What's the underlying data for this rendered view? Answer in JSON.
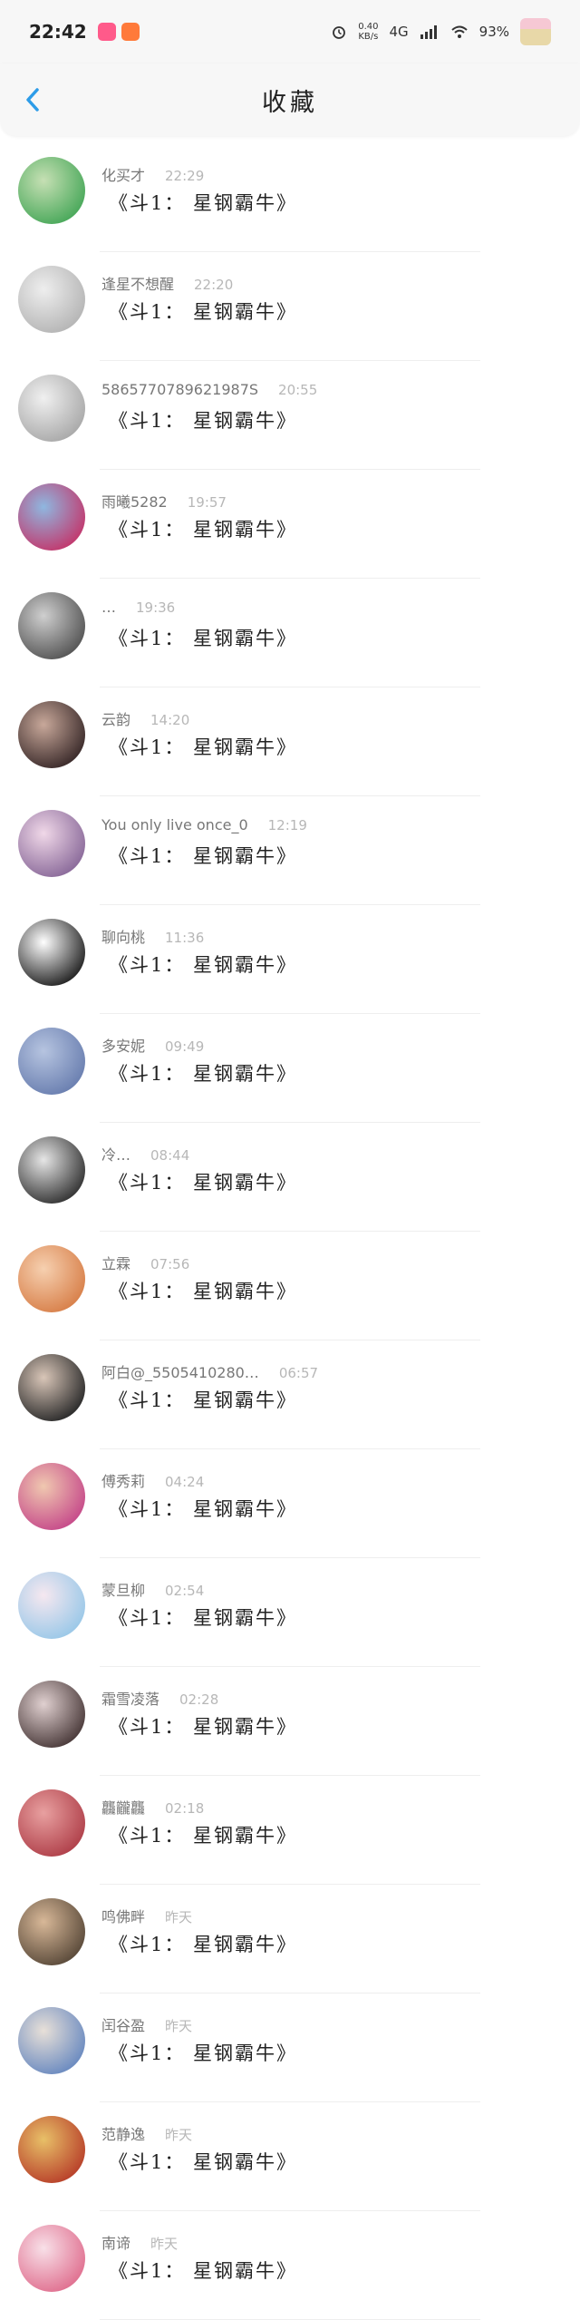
{
  "status_bar": {
    "time": "22:42",
    "net_speed_value": "0.40",
    "net_speed_unit": "KB/s",
    "network": "4G",
    "battery": "93%"
  },
  "header": {
    "title": "收藏",
    "back_icon": "chevron-left-icon"
  },
  "items": [
    {
      "name": "化买才",
      "time": "22:29",
      "message": "《斗1： 星钢霸牛》",
      "avatar_colors": [
        "#49a85a",
        "#c6e0b4"
      ]
    },
    {
      "name": "逢星不想醒",
      "time": "22:20",
      "message": "《斗1： 星钢霸牛》",
      "avatar_colors": [
        "#b5b5b5",
        "#eeeeee"
      ]
    },
    {
      "name": "5865770789621987S",
      "time": "20:55",
      "message": "《斗1： 星钢霸牛》",
      "avatar_colors": [
        "#a9a9a9",
        "#f0f0f0"
      ]
    },
    {
      "name": "雨曦5282",
      "time": "19:57",
      "message": "《斗1： 星钢霸牛》",
      "avatar_colors": [
        "#c2386d",
        "#8fb7e0"
      ]
    },
    {
      "name": "…",
      "time": "19:36",
      "message": "《斗1： 星钢霸牛》",
      "avatar_colors": [
        "#555555",
        "#cfcfcf"
      ]
    },
    {
      "name": "云韵",
      "time": "14:20",
      "message": "《斗1： 星钢霸牛》",
      "avatar_colors": [
        "#3a2a2a",
        "#c8a89a"
      ]
    },
    {
      "name": "You only live once_0",
      "time": "12:19",
      "message": "《斗1： 星钢霸牛》",
      "avatar_colors": [
        "#8a6a9a",
        "#f0d8e8"
      ]
    },
    {
      "name": "聊向桃",
      "time": "11:36",
      "message": "《斗1： 星钢霸牛》",
      "avatar_colors": [
        "#222222",
        "#ffffff"
      ]
    },
    {
      "name": "多安妮",
      "time": "09:49",
      "message": "《斗1： 星钢霸牛》",
      "avatar_colors": [
        "#6a7fb0",
        "#b6c4e0"
      ]
    },
    {
      "name": "冷…",
      "time": "08:44",
      "message": "《斗1： 星钢霸牛》",
      "avatar_colors": [
        "#333333",
        "#e6e6e6"
      ]
    },
    {
      "name": "立霖",
      "time": "07:56",
      "message": "《斗1： 星钢霸牛》",
      "avatar_colors": [
        "#d8804a",
        "#f6d0b0"
      ]
    },
    {
      "name": "阿白@_5505410280…",
      "time": "06:57",
      "message": "《斗1： 星钢霸牛》",
      "avatar_colors": [
        "#2a2a2a",
        "#d9c6b8"
      ]
    },
    {
      "name": "傅秀莉",
      "time": "04:24",
      "message": "《斗1： 星钢霸牛》",
      "avatar_colors": [
        "#c64a8a",
        "#f0c8b0"
      ]
    },
    {
      "name": "蒙旦柳",
      "time": "02:54",
      "message": "《斗1： 星钢霸牛》",
      "avatar_colors": [
        "#9ac8e8",
        "#f6e8f0"
      ]
    },
    {
      "name": "霜雪凌落",
      "time": "02:28",
      "message": "《斗1： 星钢霸牛》",
      "avatar_colors": [
        "#4a3a3a",
        "#e0d0d0"
      ]
    },
    {
      "name": "龘龖龘",
      "time": "02:18",
      "message": "《斗1： 星钢霸牛》",
      "avatar_colors": [
        "#b0404a",
        "#e8a0a0"
      ]
    },
    {
      "name": "鸣佛畔",
      "time": "昨天",
      "message": "《斗1： 星钢霸牛》",
      "avatar_colors": [
        "#5a4a3a",
        "#d8b898"
      ]
    },
    {
      "name": "闰谷盈",
      "time": "昨天",
      "message": "《斗1： 星钢霸牛》",
      "avatar_colors": [
        "#6a8ac0",
        "#e8e0d8"
      ]
    },
    {
      "name": "范静逸",
      "time": "昨天",
      "message": "《斗1： 星钢霸牛》",
      "avatar_colors": [
        "#b8402a",
        "#e8c068"
      ]
    },
    {
      "name": "南谛",
      "time": "昨天",
      "message": "《斗1： 星钢霸牛》",
      "avatar_colors": [
        "#e07090",
        "#f8e0e8"
      ]
    }
  ]
}
